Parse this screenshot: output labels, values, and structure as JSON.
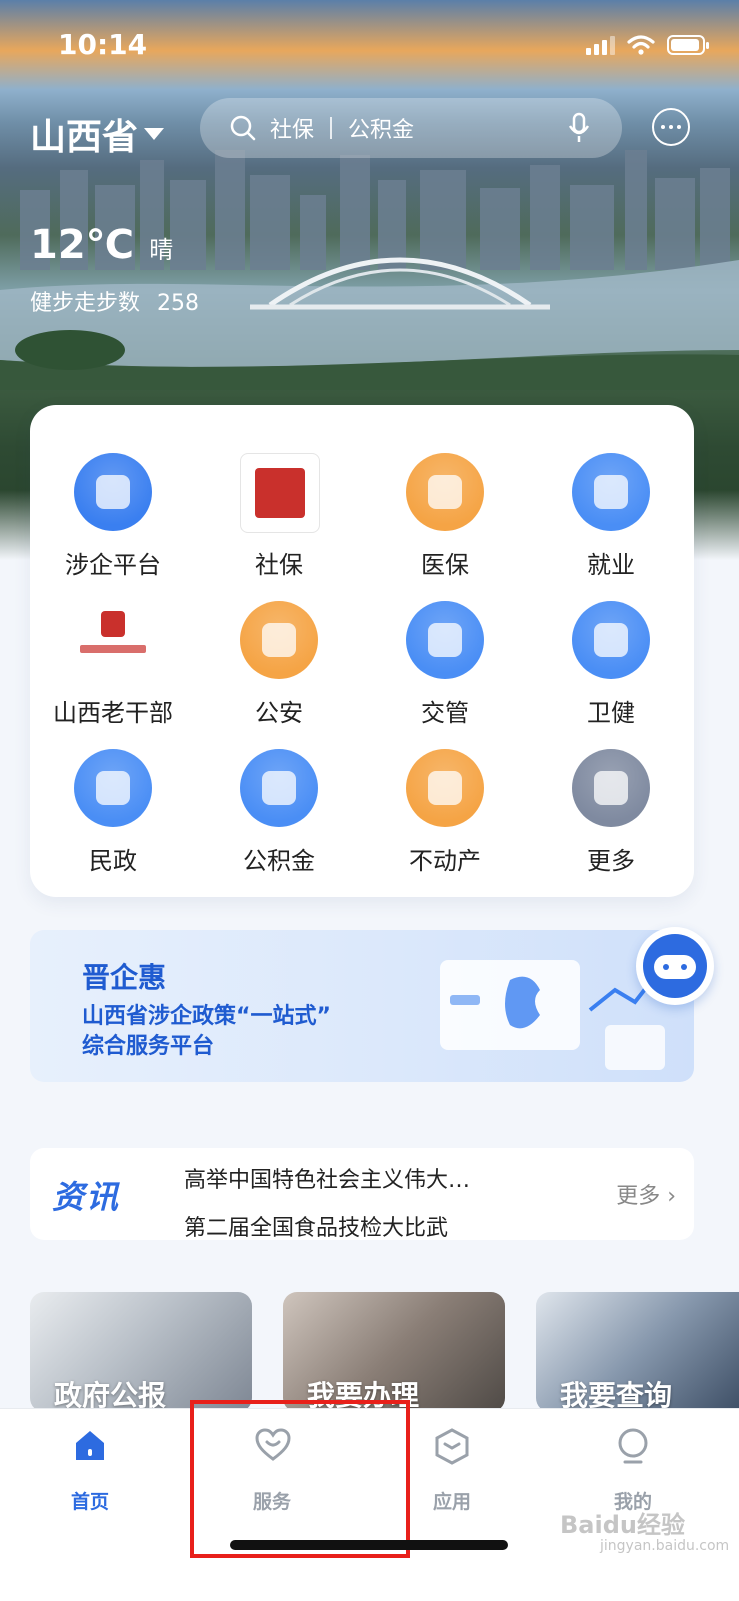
{
  "status_bar": {
    "time": "10:14"
  },
  "header": {
    "location": "山西省",
    "search_hint_1": "社保",
    "search_hint_2": "公积金"
  },
  "weather": {
    "temperature": "12℃",
    "condition": "晴",
    "steps_label": "健步走步数",
    "steps_value": "258"
  },
  "services": [
    {
      "label": "涉企平台",
      "icon": "enterprise-platform-icon",
      "color": "#3a7ff0"
    },
    {
      "label": "社保",
      "icon": "social-security-seal-icon",
      "color": "#c9302c"
    },
    {
      "label": "医保",
      "icon": "medical-insurance-icon",
      "color": "#f5a445"
    },
    {
      "label": "就业",
      "icon": "employment-briefcase-icon",
      "color": "#4a8ef5"
    },
    {
      "label": "山西老干部",
      "icon": "veteran-cadre-logo-icon",
      "color": "#c9302c"
    },
    {
      "label": "公安",
      "icon": "police-badge-icon",
      "color": "#f5a445"
    },
    {
      "label": "交管",
      "icon": "traffic-light-icon",
      "color": "#4a8ef5"
    },
    {
      "label": "卫健",
      "icon": "health-heart-icon",
      "color": "#4a8ef5"
    },
    {
      "label": "民政",
      "icon": "civil-affairs-icon",
      "color": "#4a8ef5"
    },
    {
      "label": "公积金",
      "icon": "housing-fund-icon",
      "color": "#4a8ef5"
    },
    {
      "label": "不动产",
      "icon": "real-estate-building-icon",
      "color": "#f5a445"
    },
    {
      "label": "更多",
      "icon": "more-grid-icon",
      "color": "#7f8aa0"
    }
  ],
  "banner": {
    "title": "晋企惠",
    "line1": "山西省涉企政策“一站式”",
    "line2": "综合服务平台"
  },
  "news": {
    "tag": "资讯",
    "headline_1": "高举中国特色社会主义伟大…",
    "headline_2": "第二届全国食品技检大比武",
    "more": "更多 ›"
  },
  "quick_cards": [
    {
      "label": "政府公报"
    },
    {
      "label": "我要办理"
    },
    {
      "label": "我要查询"
    }
  ],
  "tabs": [
    {
      "label": "首页",
      "icon": "home-icon",
      "active": true
    },
    {
      "label": "服务",
      "icon": "heart-smile-icon",
      "active": false
    },
    {
      "label": "应用",
      "icon": "cube-icon",
      "active": false
    },
    {
      "label": "我的",
      "icon": "profile-icon",
      "active": false
    }
  ],
  "watermark": {
    "text": "Baidu经验",
    "sub": "jingyan.baidu.com"
  },
  "colors": {
    "accent": "#2d6be0",
    "highlight": "#e8201a"
  }
}
